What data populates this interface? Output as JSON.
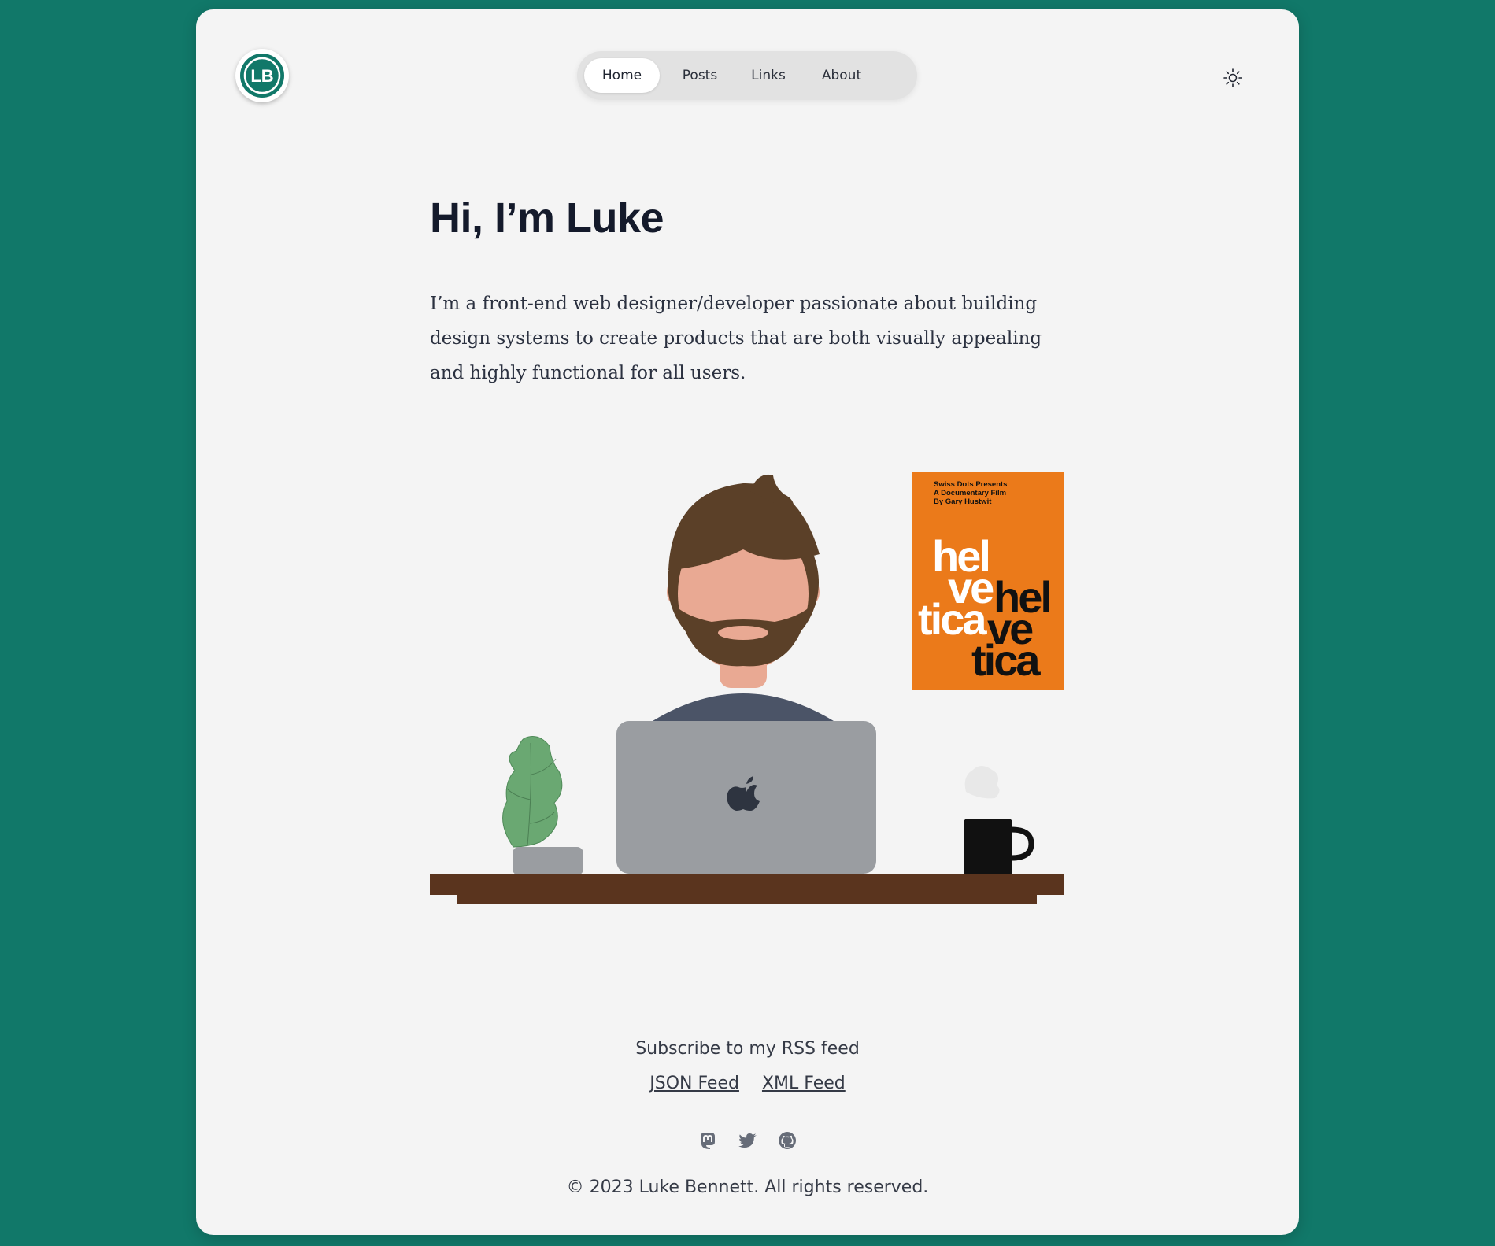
{
  "site": {
    "logo_text": "LB",
    "brand_color": "#117869"
  },
  "nav": {
    "items": [
      {
        "label": "Home",
        "active": true
      },
      {
        "label": "Posts",
        "active": false
      },
      {
        "label": "Links",
        "active": false
      },
      {
        "label": "About",
        "active": false
      }
    ],
    "theme_toggle_icon": "sun-icon"
  },
  "hero": {
    "title": "Hi, I’m Luke",
    "intro": "I’m a front-end web designer/developer passionate about building design systems to create products that are both visually appealing and highly functional for all users."
  },
  "illustration": {
    "poster": {
      "caption_lines": [
        "Swiss Dots Presents",
        "A Documentary Film",
        "By Gary Hustwit"
      ],
      "white_words": [
        "hel",
        "ve",
        "tica"
      ],
      "black_words": [
        "hel",
        "ve",
        "tica"
      ],
      "color": "#eb7a1a"
    }
  },
  "footer": {
    "rss_text": "Subscribe to my RSS feed",
    "feeds": [
      "JSON Feed",
      "XML Feed"
    ],
    "social_icons": [
      "mastodon-icon",
      "twitter-icon",
      "github-icon"
    ],
    "copyright": "© 2023 Luke Bennett. All rights reserved."
  }
}
